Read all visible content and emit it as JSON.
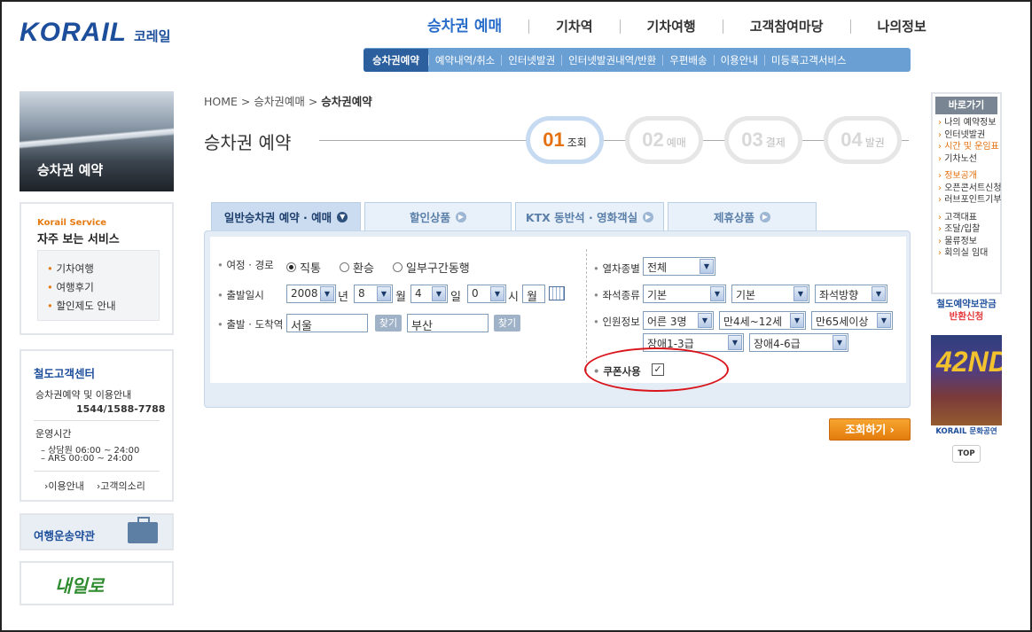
{
  "header": {
    "logo_en": "KORAIL",
    "logo_ko": "코레일",
    "nav": [
      "승차권 예매",
      "기차역",
      "기차여행",
      "고객참여마당",
      "나의정보"
    ],
    "subnav": [
      "승차권예약",
      "예약내역/취소",
      "인터넷발권",
      "인터넷발권내역/반환",
      "우편배송",
      "이용안내",
      "미등록고객서비스"
    ]
  },
  "sidebar": {
    "banner_title": "승차권 예약",
    "service_sub": "Korail Service",
    "service_title": "자주 보는 서비스",
    "service_items": [
      "기차여행",
      "여행후기",
      "할인제도 안내"
    ],
    "center_title": "철도고객센터",
    "center_line1": "승차권예약 및 이용안내",
    "center_tel": "1544/1588-7788",
    "hours_title": "운영시간",
    "hours_1": "– 상담원   06:00 ~ 24:00",
    "hours_2": "– ARS      00:00 ~ 24:00",
    "link1": "›이용안내",
    "link2": "›고객의소리",
    "terms": "여행운송약관",
    "nae_logo": "내일로"
  },
  "main": {
    "breadcrumb_home": "HOME",
    "breadcrumb_mid": "승차권예매",
    "breadcrumb_cur": "승차권예약",
    "title": "승차권 예약",
    "steps": [
      {
        "num": "01",
        "label": "조회"
      },
      {
        "num": "02",
        "label": "예매"
      },
      {
        "num": "03",
        "label": "결제"
      },
      {
        "num": "04",
        "label": "발권"
      }
    ],
    "tabs": [
      "일반승차권 예약 · 예매",
      "할인상품",
      "KTX 동반석 · 영화객실",
      "제휴상품"
    ],
    "form": {
      "route_label": "여정 · 경로",
      "route_options": [
        "직통",
        "환승",
        "일부구간동행"
      ],
      "date_label": "출발일시",
      "year": "2008",
      "year_unit": "년",
      "month": "8",
      "month_unit": "월",
      "day": "4",
      "day_unit": "일",
      "hour": "0",
      "hour_unit": "시",
      "weekday": "월",
      "station_label": "출발 · 도착역",
      "dep": "서울",
      "arr": "부산",
      "find_btn": "찾기",
      "train_label": "열차종별",
      "train_value": "전체",
      "seat_label": "좌석종류",
      "seat_1": "기본",
      "seat_2": "기본",
      "seat_3": "좌석방향",
      "people_label": "인원정보",
      "adult": "어른 3명",
      "child": "만4세~12세",
      "senior": "만65세이상",
      "dis1": "장애1-3급",
      "dis2": "장애4-6급",
      "coupon_label": "쿠폰사용",
      "coupon_checked": true
    },
    "search_btn": "조회하기 ›"
  },
  "right": {
    "quick_title": "바로가기",
    "quick_items": [
      "나의 예약정보",
      "인터넷발권",
      "시간 및 운임표",
      "기차노선",
      "정보공개",
      "오픈콘서트신청",
      "러브포인트기부",
      "고객대표",
      "조달/입찰",
      "물류정보",
      "회의실 임대"
    ],
    "ad_line1": "철도예약보관금",
    "ad_line2": "반환신청",
    "poster_text": "42ND",
    "poster_caption": "KORAIL 문화공연",
    "top": "TOP"
  },
  "colors": {
    "brand": "#1d4e9b",
    "accent": "#e5700f",
    "highlight": "#d9151b"
  }
}
